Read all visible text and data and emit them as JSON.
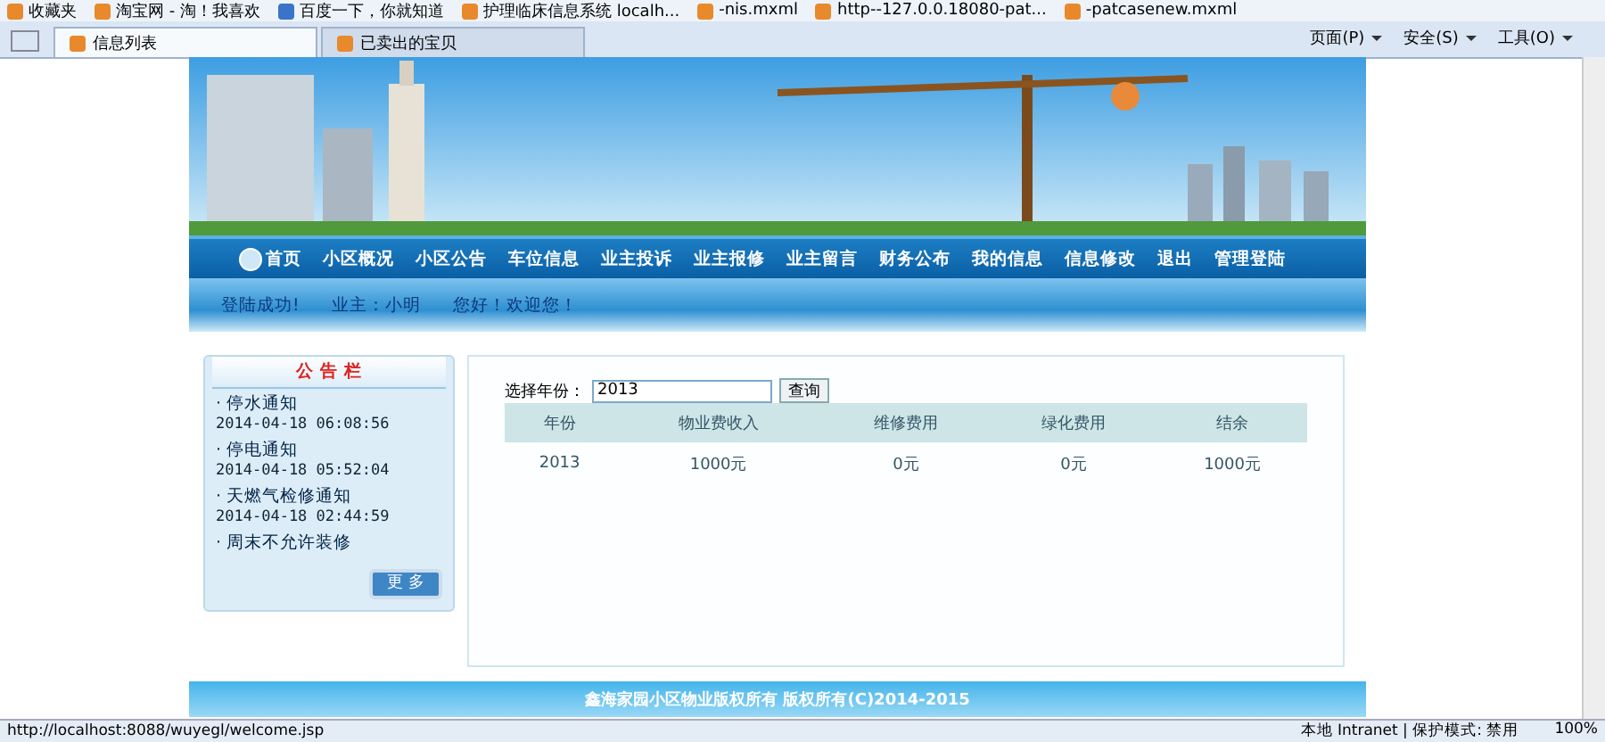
{
  "favorites_bar": {
    "label": "收藏夹",
    "links": [
      "淘宝网 - 淘！我喜欢",
      "百度一下，你就知道",
      "护理临床信息系统 localh...",
      "-nis.mxml",
      "http--127.0.0.18080-pat...",
      "-patcasenew.mxml"
    ]
  },
  "tabs": [
    {
      "label": "信息列表",
      "selected": true
    },
    {
      "label": "已卖出的宝贝",
      "selected": false
    }
  ],
  "command_bar": [
    "页面(P)",
    "安全(S)",
    "工具(O)"
  ],
  "nav": [
    "首页",
    "小区概况",
    "小区公告",
    "车位信息",
    "业主投诉",
    "业主报修",
    "业主留言",
    "财务公布",
    "我的信息",
    "信息修改",
    "退出",
    "管理登陆"
  ],
  "welcome": [
    "登陆成功!",
    "业主：小明",
    "您好！欢迎您！"
  ],
  "notice_board": {
    "title": "公 告 栏",
    "items": [
      {
        "title": "· 停水通知",
        "time": "2014-04-18 06:08:56"
      },
      {
        "title": "· 停电通知",
        "time": "2014-04-18 05:52:04"
      },
      {
        "title": "· 天燃气检修通知",
        "time": "2014-04-18 02:44:59"
      },
      {
        "title": "· 周末不允许装修"
      }
    ],
    "more": "更 多"
  },
  "query": {
    "label": "选择年份：",
    "value": "2013",
    "button": "查询"
  },
  "table": {
    "columns": [
      "年份",
      "物业费收入",
      "维修费用",
      "绿化费用",
      "结余"
    ],
    "rows": [
      [
        "2013",
        "1000元",
        "0元",
        "0元",
        "1000元"
      ]
    ]
  },
  "footer": "鑫海家园小区物业版权所有  版权所有(C)2014-2015",
  "status_bar": {
    "url": "http://localhost:8088/wuyegl/welcome.jsp",
    "zone": "本地 Intranet | 保护模式: 禁用",
    "zoom": "100%"
  }
}
